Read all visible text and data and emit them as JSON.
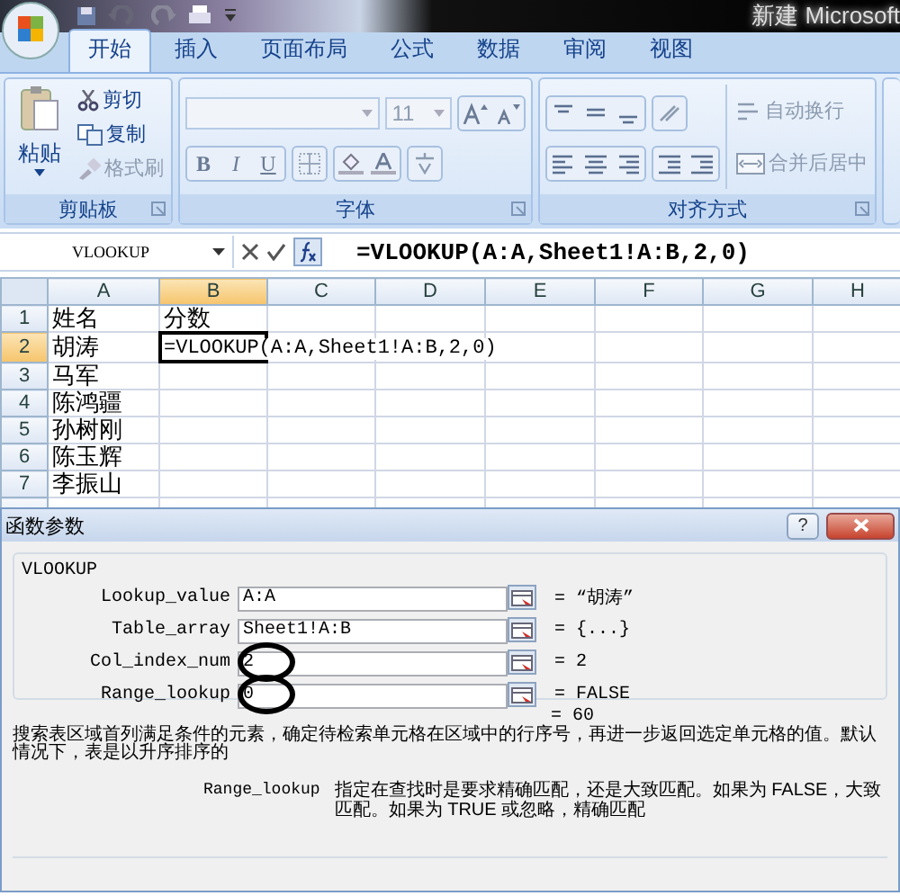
{
  "title_bar": {
    "title": "新建 Microsoft"
  },
  "ribbon": {
    "tabs": [
      {
        "label": "开始",
        "selected": true
      },
      {
        "label": "插入",
        "selected": false
      },
      {
        "label": "页面布局",
        "selected": false
      },
      {
        "label": "公式",
        "selected": false
      },
      {
        "label": "数据",
        "selected": false
      },
      {
        "label": "审阅",
        "selected": false
      },
      {
        "label": "视图",
        "selected": false
      }
    ],
    "clipboard": {
      "paste": "粘贴",
      "group": "剪贴板",
      "items": [
        {
          "label": "剪切",
          "disabled": false
        },
        {
          "label": "复制",
          "disabled": false
        },
        {
          "label": "格式刷",
          "disabled": true
        }
      ]
    },
    "font": {
      "size": "11",
      "style_buttons": [
        "B",
        "I",
        "U"
      ],
      "group": "字体"
    },
    "alignment": {
      "group": "对齐方式",
      "items": [
        {
          "label": "自动换行",
          "disabled": true
        },
        {
          "label": "合并后居中",
          "disabled": true
        }
      ]
    }
  },
  "formula_bar": {
    "name_box": "VLOOKUP",
    "formula": "=VLOOKUP(A:A,Sheet1!A:B,2,0)"
  },
  "sheet": {
    "columns": [
      {
        "label": "A",
        "selected": false
      },
      {
        "label": "B",
        "selected": true
      },
      {
        "label": "C",
        "selected": false
      },
      {
        "label": "D",
        "selected": false
      },
      {
        "label": "E",
        "selected": false
      },
      {
        "label": "F",
        "selected": false
      },
      {
        "label": "G",
        "selected": false
      },
      {
        "label": "H",
        "selected": false
      }
    ],
    "rows": [
      {
        "label": "1",
        "selected": false,
        "cells": [
          "姓名",
          "分数"
        ]
      },
      {
        "label": "2",
        "selected": true,
        "cells": [
          "胡涛",
          "=VLOOKUP(A:A,Sheet1!A:B,2,0)"
        ]
      },
      {
        "label": "3",
        "selected": false,
        "cells": [
          "马军"
        ]
      },
      {
        "label": "4",
        "selected": false,
        "cells": [
          "陈鸿疆"
        ]
      },
      {
        "label": "5",
        "selected": false,
        "cells": [
          "孙树刚"
        ]
      },
      {
        "label": "6",
        "selected": false,
        "cells": [
          "陈玉辉"
        ]
      },
      {
        "label": "7",
        "selected": false,
        "cells": [
          "李振山"
        ]
      }
    ]
  },
  "dialog": {
    "title": "函数参数",
    "help_button": "?",
    "function": "VLOOKUP",
    "params": [
      {
        "label": "Lookup_value",
        "value": "A:A",
        "result": "= “胡涛”",
        "circled": false
      },
      {
        "label": "Table_array",
        "value": "Sheet1!A:B",
        "result": "= {...}",
        "circled": false
      },
      {
        "label": "Col_index_num",
        "value": "2",
        "result": "= 2",
        "circled": true
      },
      {
        "label": "Range_lookup",
        "value": "0",
        "result": "= FALSE",
        "circled": true
      }
    ],
    "total": "= 60",
    "description": "搜索表区域首列满足条件的元素，确定待检索单元格在区域中的行序号，再进一步返回选定单元格的值。默认情况下，表是以升序排序的",
    "help": {
      "label": "Range_lookup",
      "text": "指定在查找时是要求精确匹配，还是大致匹配。如果为 FALSE，大致匹配。如果为 TRUE 或忽略，精确匹配"
    }
  }
}
